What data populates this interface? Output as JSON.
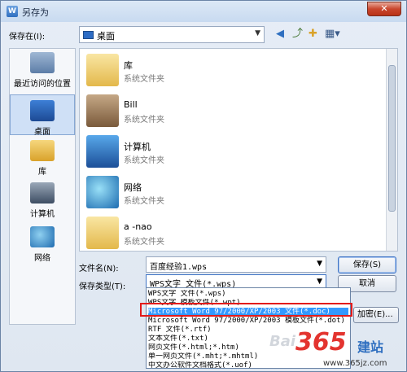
{
  "window": {
    "title": "另存为",
    "app_icon": "W"
  },
  "location": {
    "label": "保存在(I):",
    "value": "桌面"
  },
  "sidebar": {
    "items": [
      {
        "label": "最近访问的位置",
        "icon": "recent-places-icon"
      },
      {
        "label": "桌面",
        "icon": "desktop-icon"
      },
      {
        "label": "库",
        "icon": "library-icon"
      },
      {
        "label": "计算机",
        "icon": "computer-icon"
      },
      {
        "label": "网络",
        "icon": "network-icon"
      }
    ]
  },
  "files": [
    {
      "name": "库",
      "type": "系统文件夹"
    },
    {
      "name": "Bill",
      "type": "系统文件夹"
    },
    {
      "name": "计算机",
      "type": "系统文件夹"
    },
    {
      "name": "网络",
      "type": "系统文件夹"
    },
    {
      "name": "a -nao",
      "type": "系统文件夹"
    }
  ],
  "form": {
    "filename_label": "文件名(N):",
    "filename_value": "百度经验1.wps",
    "filetype_label": "保存类型(T):",
    "filetype_value": "WPS文字 文件(*.wps)",
    "save_button": "保存(S)",
    "cancel_button": "取消",
    "partial_button": "加密(E)..."
  },
  "filetype_options": [
    "WPS文字 文件(*.wps)",
    "WPS文字 模板文件(*.wpt)",
    "Microsoft Word 97/2000/XP/2003 文件(*.doc)",
    "Microsoft Word 97/2000/XP/2003 模板文件(*.dot)",
    "RTF 文件(*.rtf)",
    "文本文件(*.txt)",
    "网页文件(*.html;*.htm)",
    "单一网页文件(*.mht;*.mhtml)",
    "中文办公软件文档格式(*.uof)"
  ],
  "watermark": {
    "part1": "Bai",
    "part2": "365",
    "part3": "建站",
    "url": "www.365jz.com"
  },
  "colors": {
    "highlight": "#3399ff",
    "red_box": "#e31b1b"
  }
}
